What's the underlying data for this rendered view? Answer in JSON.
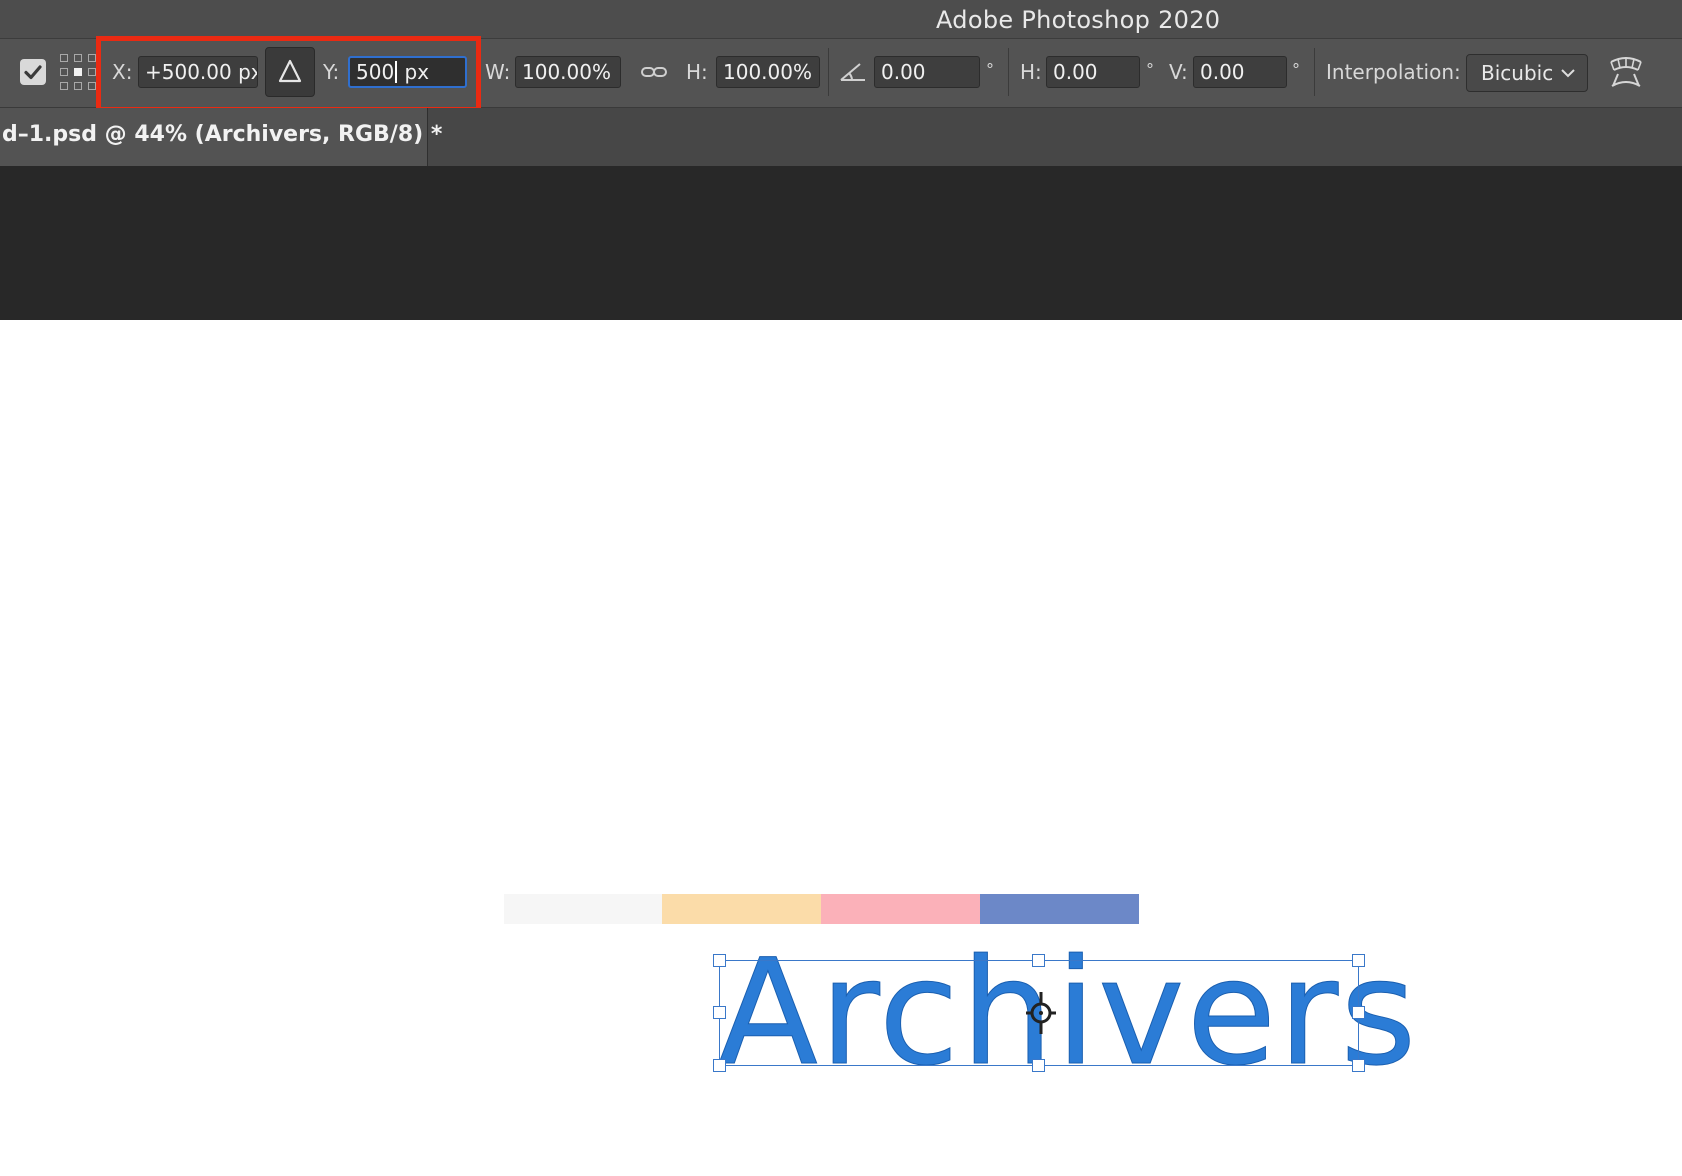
{
  "app": {
    "title": "Adobe Photoshop 2020"
  },
  "options_bar": {
    "x_label": "X:",
    "x_value": "+500.00 px",
    "y_label": "Y:",
    "y_value_before_caret": "500",
    "y_value_after_caret": " px",
    "w_label": "W:",
    "w_value": "100.00%",
    "h_label": "H:",
    "h_value": "100.00%",
    "angle_value": "0.00",
    "degree_symbol": "°",
    "skew_h_label": "H:",
    "skew_h_value": "0.00",
    "skew_v_label": "V:",
    "skew_v_value": "0.00",
    "interpolation_label": "Interpolation:",
    "interpolation_value": "Bicubic",
    "icons": [
      "commit-checkbox-icon",
      "reference-point-grid-icon",
      "delta-relative-icon",
      "link-icon",
      "angle-icon",
      "warp-icon",
      "chevron-down-icon"
    ]
  },
  "document_tab": {
    "label": "d–1.psd @ 44% (Archivers, RGB/8) *"
  },
  "canvas": {
    "layer_text": "Archivers",
    "text_color": "#2b7cd6",
    "swatches": [
      "#f6f6f6",
      "#fbdca9",
      "#fbb1b9",
      "#6c88c8"
    ]
  },
  "colors": {
    "highlight": "#ea2a12",
    "accent": "#2f6fcf"
  }
}
